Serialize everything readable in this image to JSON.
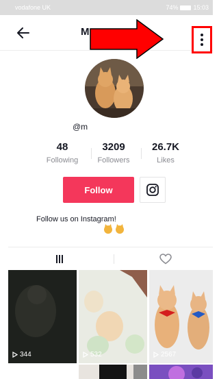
{
  "status_bar": {
    "carrier": "vodafone UK",
    "battery": "74%",
    "time": "15:03"
  },
  "nav": {
    "title": "M"
  },
  "profile": {
    "username": "@m"
  },
  "stats": [
    {
      "value": "48",
      "label": "Following"
    },
    {
      "value": "3209",
      "label": "Followers"
    },
    {
      "value": "26.7K",
      "label": "Likes"
    }
  ],
  "actions": {
    "follow_label": "Follow"
  },
  "bio": {
    "text": "Follow us on Instagram!"
  },
  "tabs": [
    {
      "icon": "grid-icon"
    },
    {
      "icon": "heart-icon"
    }
  ],
  "videos": [
    {
      "views": "344"
    },
    {
      "views": "532"
    },
    {
      "views": "2567"
    }
  ],
  "colors": {
    "follow": "#f4375b",
    "highlight": "#ff0000"
  }
}
